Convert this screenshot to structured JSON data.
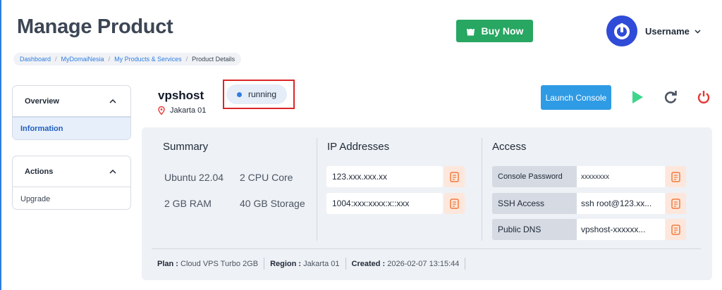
{
  "page": {
    "title": "Manage Product"
  },
  "header": {
    "buy_button": "Buy Now",
    "username": "Username"
  },
  "breadcrumb": [
    {
      "label": "Dashboard"
    },
    {
      "label": "MyDomaiNesia"
    },
    {
      "label": "My Products & Services"
    },
    {
      "label": "Product Details"
    }
  ],
  "sidebar": {
    "overview": {
      "title": "Overview",
      "items": [
        {
          "label": "Information",
          "active": true
        }
      ]
    },
    "actions": {
      "title": "Actions",
      "items": [
        {
          "label": "Upgrade",
          "active": false
        }
      ]
    }
  },
  "server": {
    "name": "vpshost",
    "location": "Jakarta 01",
    "status": "running"
  },
  "toolbar": {
    "launch_console": "Launch Console",
    "icons": [
      "play-icon",
      "restart-icon",
      "power-icon"
    ]
  },
  "summary": {
    "title": "Summary",
    "os": "Ubuntu 22.04",
    "cpu": "2 CPU Core",
    "ram": "2 GB RAM",
    "storage": "40 GB Storage"
  },
  "ip_addresses": {
    "title": "IP Addresses",
    "ipv4": "123.xxx.xxx.xx",
    "ipv6": "1004:xxx:xxxx:x::xxx"
  },
  "access": {
    "title": "Access",
    "rows": [
      {
        "label": "Console Password",
        "value": "xxxxxxxx"
      },
      {
        "label": "SSH Access",
        "value": "ssh root@123.xx..."
      },
      {
        "label": "Public DNS",
        "value": "vpshost-xxxxxx..."
      }
    ]
  },
  "footer": {
    "plan_label": "Plan :",
    "plan_value": "Cloud VPS Turbo 2GB",
    "region_label": "Region :",
    "region_value": "Jakarta 01",
    "created_label": "Created :",
    "created_value": "2026-02-07 13:15:44"
  },
  "colors": {
    "primary": "#2f7de1",
    "success": "#27a762",
    "danger": "#e53935",
    "copy_accent": "#f07b3f"
  }
}
